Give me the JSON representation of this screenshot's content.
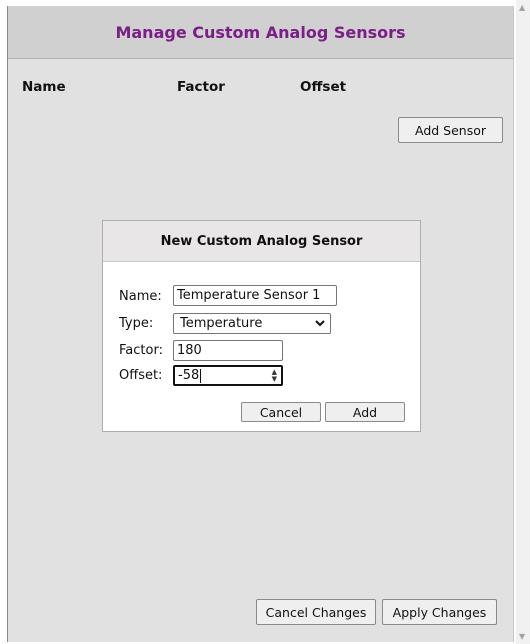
{
  "window": {
    "title": "Manage Custom Analog Sensors"
  },
  "table": {
    "columns": [
      "Name",
      "Factor",
      "Offset"
    ]
  },
  "buttons": {
    "add_sensor": "Add Sensor",
    "cancel_changes": "Cancel Changes",
    "apply_changes": "Apply Changes"
  },
  "dialog": {
    "title": "New Custom Analog Sensor",
    "name_label": "Name:",
    "name_value": "Temperature Sensor 1",
    "type_label": "Type:",
    "type_value": "Temperature",
    "factor_label": "Factor:",
    "factor_value": "180",
    "offset_label": "Offset:",
    "offset_value": "-58",
    "cancel_label": "Cancel",
    "add_label": "Add"
  },
  "icons": {
    "select_arrow": "chevron-down-icon",
    "spinner": "spinner-arrows-icon",
    "scroll_up": "scroll-up-arrow-icon",
    "scroll_down": "scroll-down-arrow-icon"
  }
}
